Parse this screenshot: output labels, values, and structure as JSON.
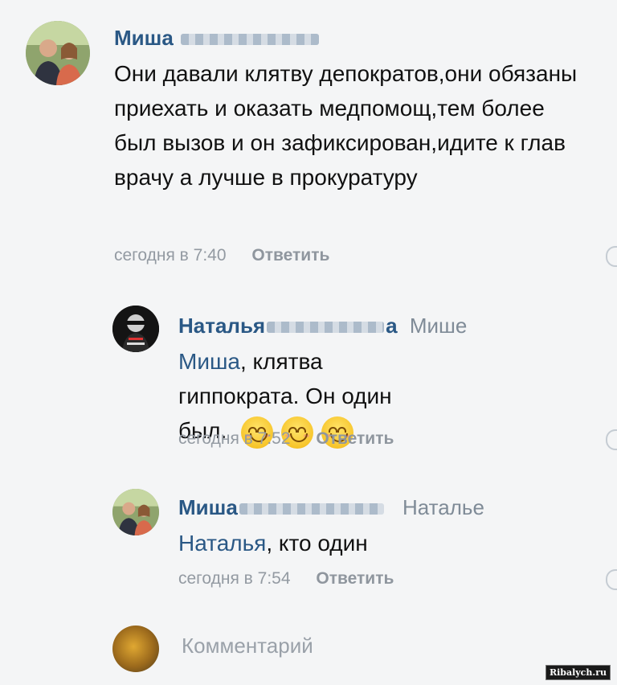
{
  "comments": [
    {
      "author": "Миша",
      "reply_to": "",
      "mention": "",
      "text": "Они давали клятву депократов,они обязаны приехать и оказать медпомощ,тем более был вызов и он зафиксирован,идите к глав врачу а лучше в прокуратуру",
      "time": "сегодня в 7:40",
      "reply_label": "Ответить"
    },
    {
      "author": "Наталья",
      "author_suffix": "а",
      "reply_to": "Мише",
      "mention": "Миша",
      "text": ", клятва гиппократа. Он один был.",
      "time": "сегодня в 7:52",
      "reply_label": "Ответить"
    },
    {
      "author": "Миша",
      "reply_to": "Наталье",
      "mention": "Наталья",
      "text": ", кто один",
      "time": "сегодня в 7:54",
      "reply_label": "Ответить"
    }
  ],
  "emojis": [
    "smiling-face-icon",
    "smiling-face-icon",
    "smiling-face-icon"
  ],
  "composer": {
    "placeholder": "Комментарий"
  },
  "watermark": "Ribalych.ru",
  "colors": {
    "link": "#2a5885",
    "meta": "#939aa2",
    "background": "#f4f5f6"
  }
}
